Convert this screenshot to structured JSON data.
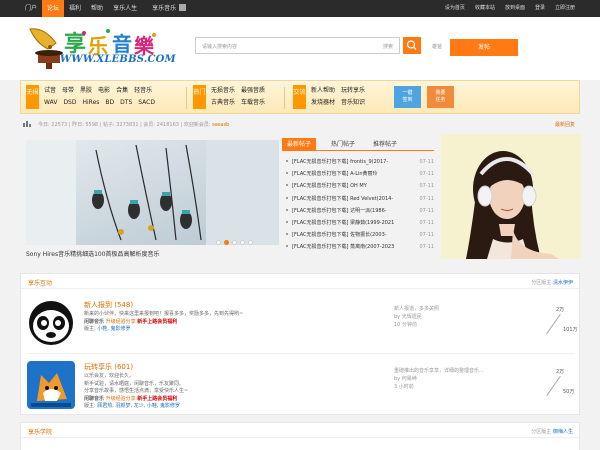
{
  "topbar": {
    "nav": [
      "门户",
      "论坛",
      "福利",
      "帮助",
      "享乐人生"
    ],
    "active_index": 1,
    "app": "享乐音乐",
    "right": [
      "设为首页",
      "收藏本站",
      "放到桌面",
      "登录",
      "立即注册"
    ]
  },
  "header": {
    "logo_text": "WWW.XLEBBS.COM",
    "search_placeholder": "请输入搜索内容",
    "search_scope": "搜索",
    "hot": "雄爸",
    "post_button": "发帖"
  },
  "banner": {
    "groups": [
      {
        "badge": "无损",
        "rows": [
          [
            "试音",
            "母带",
            "黑胶",
            "电影",
            "合集",
            "轻音乐"
          ],
          [
            "WAV",
            "DSD",
            "HiRes",
            "BD",
            "DTS",
            "SACD"
          ]
        ]
      },
      {
        "badge": "热门",
        "rows": [
          [
            "无损音乐",
            "最强音质"
          ],
          [
            "古典音乐",
            "车载音乐"
          ]
        ]
      },
      {
        "badge": "交流",
        "rows": [
          [
            "新人帮助",
            "玩转享乐"
          ],
          [
            "发烧器材",
            "音乐知识"
          ]
        ]
      }
    ],
    "quick_buttons": [
      {
        "label1": "一键",
        "label2": "签到",
        "color": "#4fa3e0"
      },
      {
        "label1": "我要",
        "label2": "任务",
        "color": "#f08a3c"
      }
    ]
  },
  "stats": {
    "today_label": "今日:",
    "today": "22573",
    "yesterday_label": "昨日:",
    "yesterday": "5598",
    "posts_label": "帖子:",
    "posts": "3273831",
    "members_label": "会员:",
    "members": "2418163",
    "welcome_label": "欢迎新会员:",
    "new_member": "sasasb",
    "latest": "最新回复"
  },
  "slider": {
    "caption": "Sony Hires音乐精挑细选100首极品高解析度音乐",
    "dots": 5,
    "active_dot": 1
  },
  "tabs": [
    "最新帖子",
    "热门帖子",
    "推荐帖子"
  ],
  "threads": [
    {
      "title": "[FLAC无损音乐打包下载] frontis_9(2017-",
      "date": "07-11"
    },
    {
      "title": "[FLAC无损音乐打包下载] A-Lin黄丽玲",
      "date": "07-11"
    },
    {
      "title": "[FLAC无损音乐打包下载] OH MY",
      "date": "07-11"
    },
    {
      "title": "[FLAC无损音乐打包下载] Red Velvet(2014-",
      "date": "07-11"
    },
    {
      "title": "[FLAC无损音乐打包下载] 达明一派(1986-",
      "date": "07-11"
    },
    {
      "title": "[FLAC无损音乐打包下载] 梁静茹(1999-2021",
      "date": "07-11"
    },
    {
      "title": "[FLAC无损音乐打包下载] 佐物振长(2003-",
      "date": "07-11"
    },
    {
      "title": "[FLAC无损音乐打包下载] 蒸离南(2007-2023",
      "date": "07-11"
    }
  ],
  "section1": {
    "title": "享乐互动",
    "mod_label": "分区版主:",
    "mod": "清水伊伊",
    "forums": [
      {
        "name": "新人报到 (548)",
        "desc1": "新来的小伙伴，快来这里来报到吧！报喜多多，奖励多多，先到先得哟~",
        "desc2_label": "闲聊音乐",
        "desc2_hl": "升级经验分享",
        "desc2_hl2": "新手上路会员福利",
        "desc3_label": "版主:",
        "desc3": "小鞋, 鬼影修罗",
        "last1": "新人报道，多多关照",
        "last2": "by 光辉遗民",
        "last3": "10 分钟前",
        "threads": "2万",
        "posts": "101万"
      },
      {
        "name": "玩转享乐 (601)",
        "desc1": "以乐会友，欢迎长久。",
        "desc1b": "新手试验，请水晒庭，闲聊音乐，乐友聚同。",
        "desc1c": "分享音乐故事，感悟生活点滴，享受快乐人生~",
        "desc2_label": "闲聊音乐",
        "desc2_hl": "升级经验分享",
        "desc2_hl2": "新手上路会员福利",
        "desc3_label": "版主:",
        "desc3": "顾君热, 羽颜梦, 龙少, 小鞋, 鬼影修罗",
        "last1": "重磅推出的音乐享享，详细的整理音乐...",
        "last2": "by 何易绅",
        "last3": "3 小时前",
        "threads": "2万",
        "posts": "50万"
      }
    ]
  },
  "section2": {
    "title": "享乐学院",
    "mod_label": "分区版主:",
    "mod": "御梅人生"
  }
}
